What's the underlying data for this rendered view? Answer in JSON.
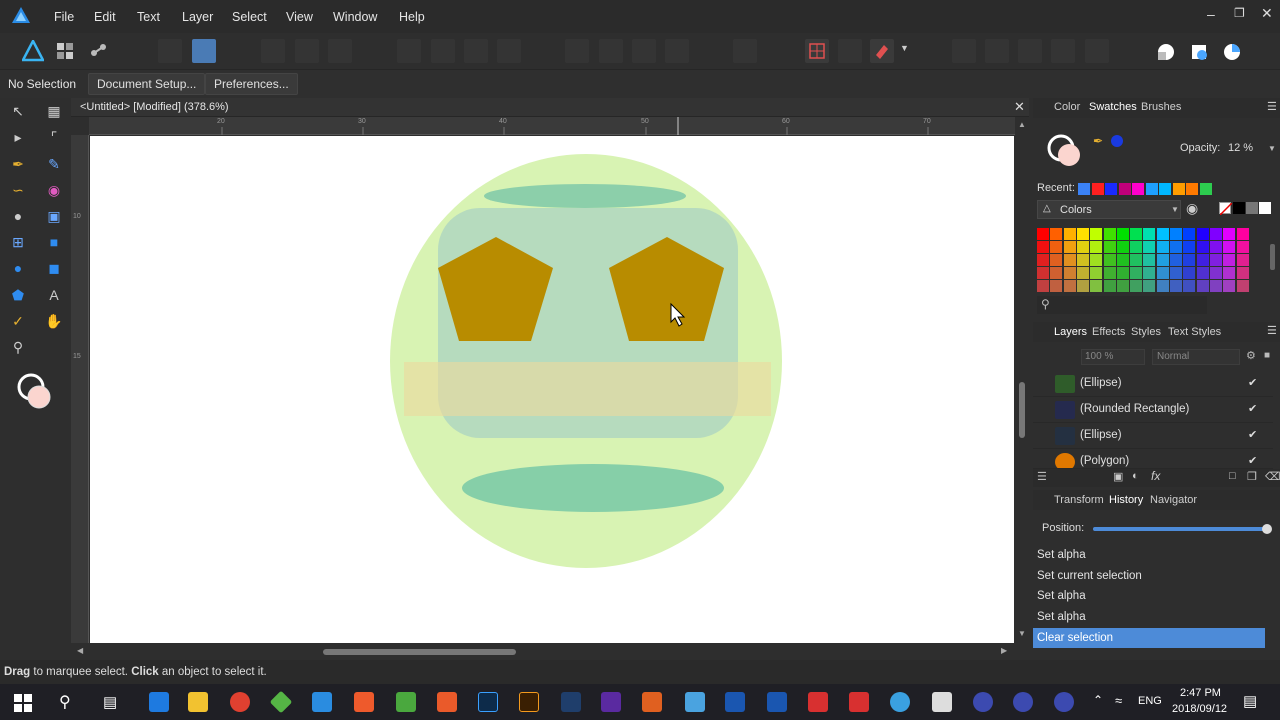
{
  "menu": [
    "File",
    "Edit",
    "Text",
    "Layer",
    "Select",
    "View",
    "Window",
    "Help"
  ],
  "context": {
    "selection": "No Selection",
    "doc_setup": "Document Setup...",
    "preferences": "Preferences..."
  },
  "document": {
    "tab_title": "<Untitled> [Modified] (378.6%)"
  },
  "ruler": {
    "h_ticks": [
      "20",
      "30",
      "40",
      "50",
      "60",
      "70"
    ],
    "v_ticks": [
      "10",
      "15"
    ]
  },
  "color_panel": {
    "tabs": [
      "Color",
      "Swatches",
      "Brushes"
    ],
    "opacity_label": "Opacity:",
    "opacity_value": "12 %",
    "recent_label": "Recent:",
    "palette_name": "Colors",
    "recent_colors": [
      "#3b82f6",
      "#ff2020",
      "#1a2aff",
      "#c0007a",
      "#ff00cc",
      "#1ea0ff",
      "#00b7ff",
      "#ff9d00",
      "#ff7a00",
      "#2dcc4f"
    ],
    "grid_colors": [
      [
        "#ff0000",
        "#ff6000",
        "#ffb000",
        "#ffe000",
        "#c0ff00",
        "#40e000",
        "#00e000",
        "#00e050",
        "#00e0b0",
        "#00c0ff",
        "#0080ff",
        "#0040ff",
        "#2000ff",
        "#8000ff",
        "#e000ff",
        "#ff00a0"
      ],
      [
        "#f01010",
        "#f06010",
        "#f0a010",
        "#e0d010",
        "#b0f010",
        "#40d010",
        "#10d010",
        "#10d060",
        "#10d0b0",
        "#10b0f0",
        "#1070f0",
        "#1040f0",
        "#3010f0",
        "#8010f0",
        "#d010f0",
        "#f010a0"
      ],
      [
        "#e02020",
        "#e06020",
        "#e09020",
        "#d0c020",
        "#a0e020",
        "#40c020",
        "#20c020",
        "#20c060",
        "#20c0a0",
        "#20a0e0",
        "#2060e0",
        "#2040e0",
        "#4020e0",
        "#8020e0",
        "#c020e0",
        "#e02090"
      ],
      [
        "#d03030",
        "#d06030",
        "#d08030",
        "#c0b030",
        "#90d030",
        "#40b030",
        "#30b030",
        "#30b060",
        "#30b090",
        "#3090d0",
        "#3060d0",
        "#3040d0",
        "#5030d0",
        "#8030d0",
        "#b030d0",
        "#d03080"
      ],
      [
        "#c04040",
        "#c06040",
        "#c07040",
        "#b0a040",
        "#80c040",
        "#40a040",
        "#40a040",
        "#40a060",
        "#40a080",
        "#4080c0",
        "#4060c0",
        "#4050c0",
        "#6040c0",
        "#8040c0",
        "#a040c0",
        "#c04070"
      ]
    ]
  },
  "layers_panel": {
    "tabs": [
      "Layers",
      "Effects",
      "Styles",
      "Text Styles"
    ],
    "opacity_value": "100 %",
    "blend_mode": "Normal",
    "layers": [
      {
        "name": "(Ellipse)",
        "thumb": "#2f5c2a"
      },
      {
        "name": "(Rounded Rectangle)",
        "thumb": "#252a4e"
      },
      {
        "name": "(Ellipse)",
        "thumb": "#243041"
      },
      {
        "name": "(Polygon)",
        "thumb": "#e07800"
      }
    ]
  },
  "history_panel": {
    "tabs": [
      "Transform",
      "History",
      "Navigator"
    ],
    "position_label": "Position:",
    "position_value": 1.0,
    "items": [
      "Set alpha",
      "Set current selection",
      "Set alpha",
      "Set alpha",
      "Clear selection"
    ],
    "selected_index": 4
  },
  "status_bar": {
    "drag": "Drag",
    "drag_text": " to marquee select. ",
    "click": "Click",
    "click_text": " an object to select it."
  },
  "clock": {
    "time": "2:47 PM",
    "date": "2018/09/12",
    "lang": "ENG"
  }
}
